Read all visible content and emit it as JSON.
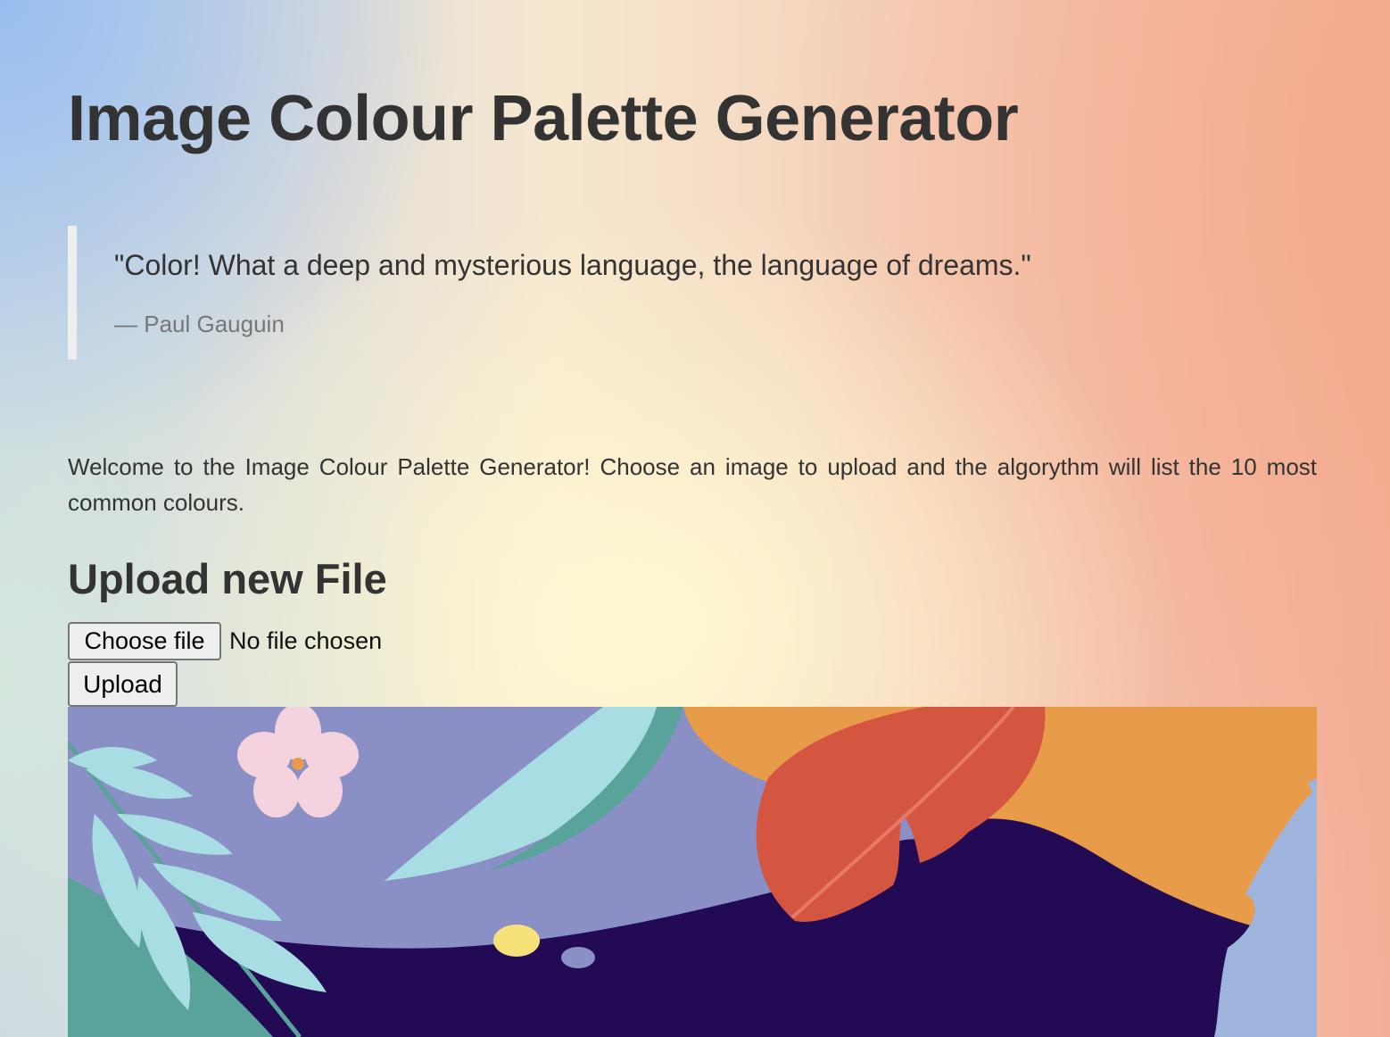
{
  "page": {
    "title": "Image Colour Palette Generator"
  },
  "quote": {
    "text": "\"Color! What a deep and mysterious language, the language of dreams.\"",
    "author": "— Paul Gauguin"
  },
  "intro": {
    "text": "Welcome to the Image Colour Palette Generator! Choose an image to upload and the algorythm will list the 10 most common colours."
  },
  "upload": {
    "heading": "Upload new File",
    "choose_label": "Choose file",
    "file_status": "No file chosen",
    "submit_label": "Upload"
  },
  "illustration": {
    "icon": "tropical-leaves-image",
    "colors": {
      "sky": "#8a8fc6",
      "orange": "#e89b48",
      "dark": "#220a55",
      "red_leaf": "#d45540",
      "teal": "#5aa39a",
      "light_leaf": "#a8dde3",
      "blue_leaf": "#9eb4dc",
      "flower": "#f4d3df",
      "yellow": "#f7e27a"
    }
  }
}
